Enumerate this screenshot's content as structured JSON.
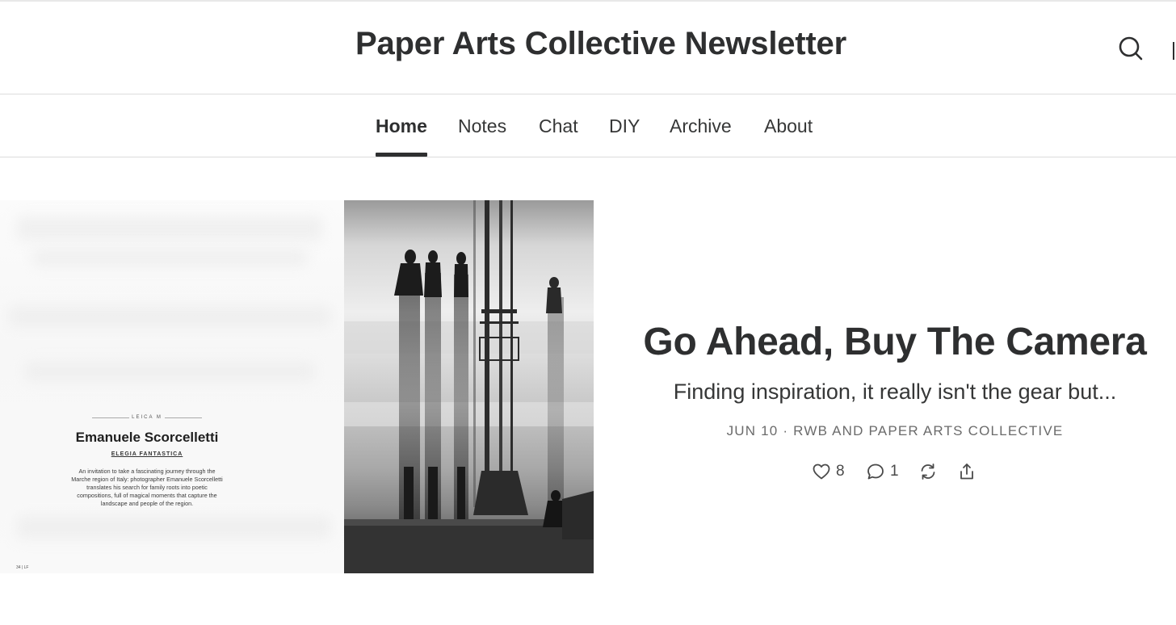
{
  "header": {
    "site_title": "Paper Arts Collective Newsletter",
    "search_icon": "search-icon"
  },
  "nav": {
    "items": [
      {
        "label": "Home",
        "active": true
      },
      {
        "label": "Notes",
        "active": false
      },
      {
        "label": "Chat",
        "active": false
      },
      {
        "label": "DIY",
        "active": false
      },
      {
        "label": "Archive",
        "active": false
      },
      {
        "label": "About",
        "active": false
      }
    ]
  },
  "featured_post": {
    "title": "Go Ahead, Buy The Camera",
    "subtitle": "Finding inspiration, it really isn't the gear but...",
    "meta": "JUN 10 · RWB AND PAPER ARTS COLLECTIVE",
    "likes": "8",
    "comments": "1",
    "icons": {
      "like": "heart-icon",
      "comment": "comment-icon",
      "restack": "restack-icon",
      "share": "share-icon"
    },
    "image": {
      "spread": {
        "kicker": "LEICA M",
        "name": "Emanuele Scorcelletti",
        "subtitle": "ELEGIA FANTASTICA",
        "body": "An invitation to take a fascinating journey through the Marche region of Italy: photographer Emanuele Scorcelletti translates his search for family roots into poetic compositions, full of magical moments that capture the landscape and people of the region.",
        "page": "34 | LF"
      }
    }
  },
  "colors": {
    "text": "#363737",
    "heading": "#2e2f30",
    "meta": "#6b6b6b",
    "divider": "#dcdcdc"
  }
}
